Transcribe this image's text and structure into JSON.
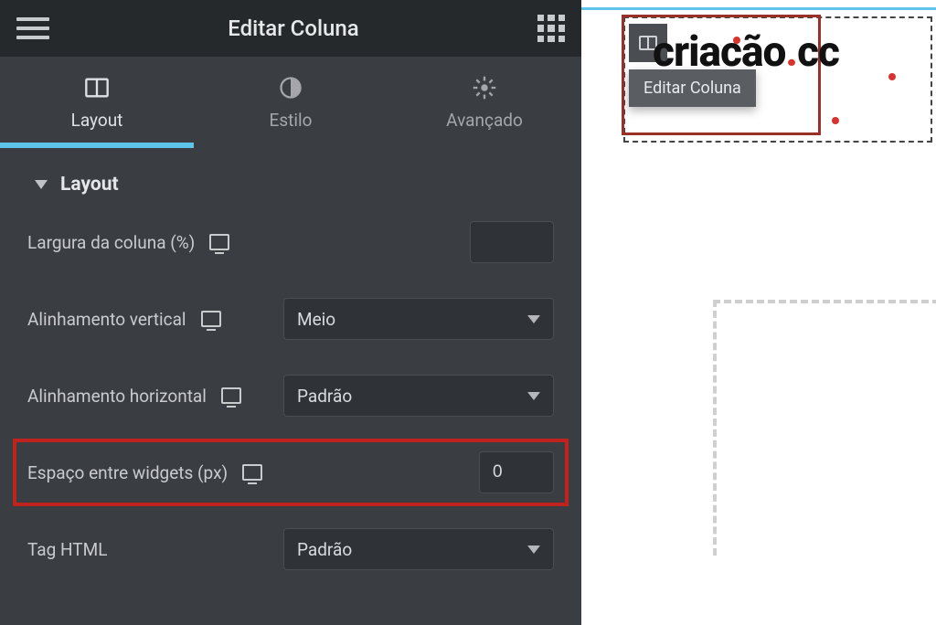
{
  "header": {
    "title": "Editar Coluna"
  },
  "tabs": {
    "layout": "Layout",
    "style": "Estilo",
    "advanced": "Avançado"
  },
  "section": {
    "title": "Layout"
  },
  "controls": {
    "column_width_label": "Largura da coluna (%)",
    "column_width_value": "",
    "valign_label": "Alinhamento vertical",
    "valign_value": "Meio",
    "halign_label": "Alinhamento horizontal",
    "halign_value": "Padrão",
    "widget_space_label": "Espaço entre widgets (px)",
    "widget_space_value": "0",
    "html_tag_label": "Tag HTML",
    "html_tag_value": "Padrão"
  },
  "canvas": {
    "logo_text_a": "criacão",
    "logo_text_b": "cc",
    "tooltip": "Editar Coluna"
  }
}
